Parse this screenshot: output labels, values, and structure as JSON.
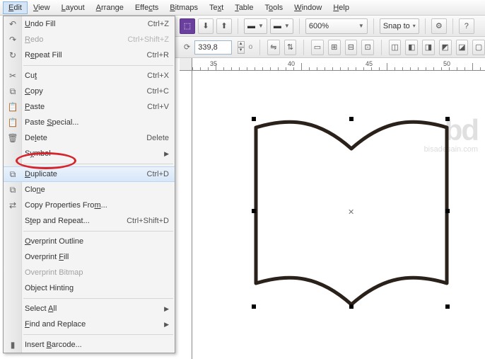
{
  "menubar": {
    "items": [
      {
        "label": "Edit",
        "u": "E",
        "open": true
      },
      {
        "label": "View",
        "u": "V"
      },
      {
        "label": "Layout",
        "u": "L"
      },
      {
        "label": "Arrange",
        "u": "A"
      },
      {
        "label": "Effects",
        "u": "E"
      },
      {
        "label": "Bitmaps",
        "u": "B"
      },
      {
        "label": "Text",
        "u": "T"
      },
      {
        "label": "Table",
        "u": "T"
      },
      {
        "label": "Tools",
        "u": "T"
      },
      {
        "label": "Window",
        "u": "W"
      },
      {
        "label": "Help",
        "u": "H"
      }
    ]
  },
  "menu": {
    "undo_fill": {
      "label": "Undo Fill",
      "shortcut": "Ctrl+Z",
      "u": "U"
    },
    "redo": {
      "label": "Redo",
      "shortcut": "Ctrl+Shift+Z",
      "u": "R"
    },
    "repeat_fill": {
      "label": "Repeat Fill",
      "shortcut": "Ctrl+R",
      "u": "R"
    },
    "cut": {
      "label": "Cut",
      "shortcut": "Ctrl+X",
      "u": "t"
    },
    "copy": {
      "label": "Copy",
      "shortcut": "Ctrl+C",
      "u": "C"
    },
    "paste": {
      "label": "Paste",
      "shortcut": "Ctrl+V",
      "u": "P"
    },
    "paste_special": {
      "label": "Paste Special...",
      "u": "S"
    },
    "delete": {
      "label": "Delete",
      "shortcut": "Delete",
      "u": "l"
    },
    "symbol": {
      "label": "Symbol",
      "u": "Y"
    },
    "duplicate": {
      "label": "Duplicate",
      "shortcut": "Ctrl+D",
      "u": "D"
    },
    "clone": {
      "label": "Clone",
      "u": "N"
    },
    "copy_props": {
      "label": "Copy Properties From...",
      "u": "M"
    },
    "step_repeat": {
      "label": "Step and Repeat...",
      "shortcut": "Ctrl+Shift+D",
      "u": "t"
    },
    "overprint_outline": {
      "label": "Overprint Outline",
      "u": "O"
    },
    "overprint_fill": {
      "label": "Overprint Fill",
      "u": "F"
    },
    "overprint_bitmap": {
      "label": "Overprint Bitmap"
    },
    "object_hinting": {
      "label": "Object Hinting"
    },
    "select_all": {
      "label": "Select All",
      "u": "A"
    },
    "find_replace": {
      "label": "Find and Replace",
      "u": "F"
    },
    "insert_barcode": {
      "label": "Insert Barcode...",
      "u": "B"
    }
  },
  "toolbar": {
    "zoom": "600%",
    "snap_to": "Snap to",
    "rotation": "339,8",
    "deg": "o"
  },
  "ruler": {
    "labels": [
      "35",
      "40",
      "45",
      "50"
    ]
  },
  "watermark": "bisadesain.com"
}
